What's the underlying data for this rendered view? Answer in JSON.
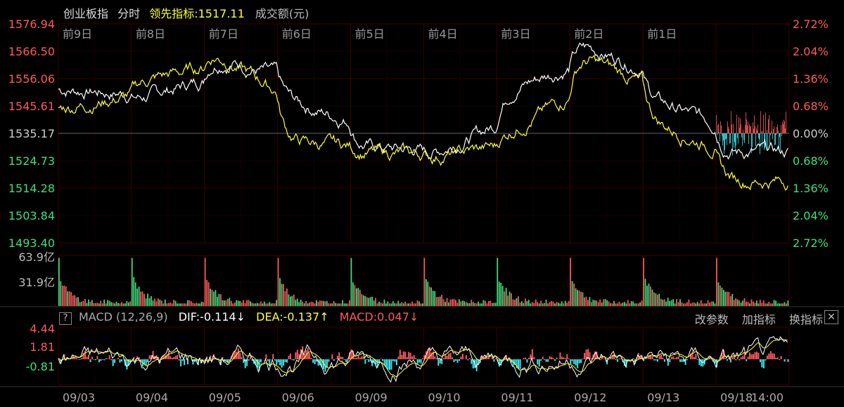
{
  "header": {
    "index_name": "创业板指",
    "mode": "分时",
    "lead_label": "领先指标:",
    "lead_value": "1517.11",
    "volume_label": "成交额(元)"
  },
  "colors": {
    "up": "#ff5a5a",
    "down": "#3ee07a",
    "price_line": "#ffffff",
    "lead_line": "#ffff3a",
    "grid": "#3a0000",
    "macd_neg": "#3de8f0"
  },
  "price_panel": {
    "y_left": [
      "1576.94",
      "1566.50",
      "1556.06",
      "1545.61",
      "1535.17",
      "1524.73",
      "1514.28",
      "1503.84",
      "1493.40"
    ],
    "y_right": [
      "2.72%",
      "2.04%",
      "1.36%",
      "0.68%",
      "0.00%",
      "0.68%",
      "1.36%",
      "2.04%",
      "2.72%"
    ],
    "day_labels": [
      "前9日",
      "前8日",
      "前7日",
      "前6日",
      "前5日",
      "前4日",
      "前3日",
      "前2日",
      "前1日"
    ]
  },
  "volume_panel": {
    "y_labels": [
      "63.9亿",
      "31.9亿"
    ]
  },
  "macd_panel": {
    "help": "?",
    "name": "MACD (12,26,9)",
    "dif": "DIF:-0.114↓",
    "dea": "DEA:-0.137↑",
    "macd": "MACD:0.047↓",
    "tools": [
      "改参数",
      "加指标",
      "换指标"
    ],
    "close": "✕",
    "y_labels": [
      "4.44",
      "1.81",
      "-0.81"
    ]
  },
  "x_labels": [
    "09/03",
    "09/04",
    "09/05",
    "09/06",
    "09/09",
    "09/10",
    "09/11",
    "09/12",
    "09/13",
    "09/18",
    "14:00"
  ],
  "chart_data": {
    "type": "line",
    "title": "创业板指 分时",
    "ylim": [
      1493.4,
      1576.94
    ],
    "prev_close": 1535.17,
    "categories": [
      "09/03",
      "09/04",
      "09/05",
      "09/06",
      "09/09",
      "09/10",
      "09/11",
      "09/12",
      "09/13",
      "09/18"
    ],
    "series": [
      {
        "name": "创业板指",
        "values": [
          1552,
          1548,
          1565,
          1548,
          1530,
          1527,
          1552,
          1570,
          1548,
          1528
        ]
      },
      {
        "name": "领先指标",
        "values": [
          1545,
          1555,
          1567,
          1532,
          1528,
          1526,
          1535,
          1566,
          1540,
          1517.11
        ]
      }
    ]
  }
}
